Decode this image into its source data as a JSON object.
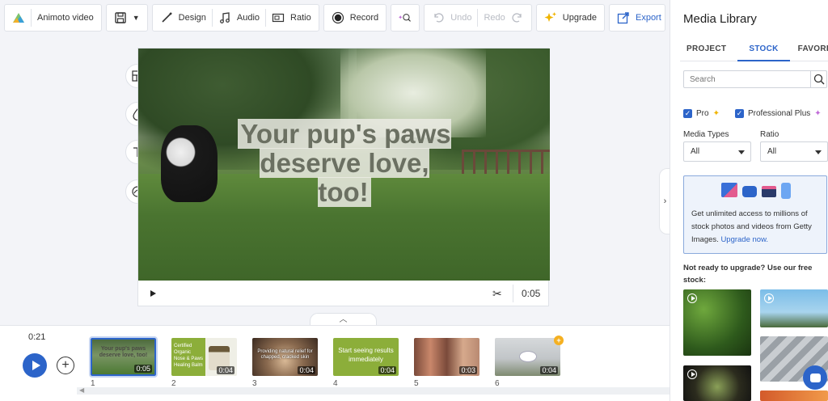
{
  "toolbar": {
    "project_name": "Animoto video",
    "design_label": "Design",
    "audio_label": "Audio",
    "ratio_label": "Ratio",
    "record_label": "Record",
    "undo_label": "Undo",
    "redo_label": "Redo",
    "upgrade_label": "Upgrade",
    "export_label": "Export"
  },
  "stage": {
    "caption": "Your pup's paws deserve love, too!",
    "duration": "0:05"
  },
  "timeline": {
    "current_time": "0:21",
    "clips": [
      {
        "number": "1",
        "duration": "0:05",
        "text": "Your pup's paws deserve love, too!",
        "selected": true
      },
      {
        "number": "2",
        "duration": "0:04",
        "text": "Certified Organic Nose & Paws Healing Balm",
        "selected": false
      },
      {
        "number": "3",
        "duration": "0:04",
        "text": "Providing natural relief for chapped, cracked skin",
        "selected": false
      },
      {
        "number": "4",
        "duration": "0:04",
        "text": "Start seeing results immediately",
        "selected": false
      },
      {
        "number": "5",
        "duration": "0:03",
        "text": "",
        "selected": false
      },
      {
        "number": "6",
        "duration": "0:04",
        "text": "",
        "selected": false
      }
    ]
  },
  "media_library": {
    "title": "Media Library",
    "tabs": [
      "PROJECT",
      "STOCK",
      "FAVORITES"
    ],
    "active_tab": "STOCK",
    "search_placeholder": "Search",
    "filter_pro": "Pro",
    "filter_professional_plus": "Professional Plus",
    "media_types_label": "Media Types",
    "media_types_value": "All",
    "ratio_label": "Ratio",
    "ratio_value": "All",
    "promo_text": "Get unlimited access to millions of stock photos and videos from Getty Images.",
    "promo_link": "Upgrade now.",
    "free_stock_text": "Not ready to upgrade? Use our free stock:"
  },
  "colors": {
    "accent": "#2c64c9",
    "background": "#f3f4f8",
    "upgrade_star": "#f0b400"
  }
}
